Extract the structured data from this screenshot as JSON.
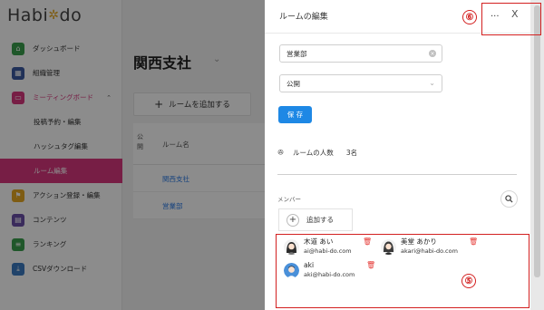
{
  "app": {
    "logo": "Habi",
    "logo_star": "✲",
    "logo_tail": "do"
  },
  "sidebar": {
    "items": [
      {
        "label": "ダッシュボード",
        "icon": "dashboard-icon",
        "color": "#3a9e4d"
      },
      {
        "label": "組織管理",
        "icon": "organization-icon",
        "color": "#3b5aa0"
      },
      {
        "label": "ミーティングボード",
        "icon": "meeting-board-icon",
        "color": "#d9377e",
        "expanded": true
      },
      {
        "label": "投稿予約・編集"
      },
      {
        "label": "ハッシュタグ編集"
      },
      {
        "label": "ルーム編集",
        "active": true
      },
      {
        "label": "アクション登録・編集",
        "icon": "flag-icon",
        "color": "#e5a823"
      },
      {
        "label": "コンテンツ",
        "icon": "book-icon",
        "color": "#6b4fa8"
      },
      {
        "label": "ランキング",
        "icon": "ranking-icon",
        "color": "#3a9e4d"
      },
      {
        "label": "CSVダウンロード",
        "icon": "download-icon",
        "color": "#3b7bc2"
      }
    ]
  },
  "main": {
    "title": "関西支社",
    "add_room_label": "ルームを追加する",
    "table": {
      "col_public": "公開",
      "col_name": "ルーム名",
      "rows": [
        "関西支社",
        "営業部"
      ]
    }
  },
  "drawer": {
    "title": "ルームの編集",
    "more": "...",
    "close": "X",
    "name_value": "営業部",
    "visibility_value": "公開",
    "save_label": "保 存",
    "member_count_label": "ルームの人数",
    "member_count_value": "3名",
    "members_label": "メンバー",
    "add_member_label": "追加する",
    "members": [
      {
        "name": "木道 あい",
        "email": "ai@habi-do.com",
        "avatar": "woman-avatar-icon"
      },
      {
        "name": "美堂 あかり",
        "email": "akari@habi-do.com",
        "avatar": "woman-avatar-icon"
      },
      {
        "name": "aki",
        "email": "aki@habi-do.com",
        "avatar": "man-avatar-icon"
      }
    ]
  },
  "annotations": {
    "top": "⑥",
    "members": "⑤",
    "color": "#d32020"
  }
}
